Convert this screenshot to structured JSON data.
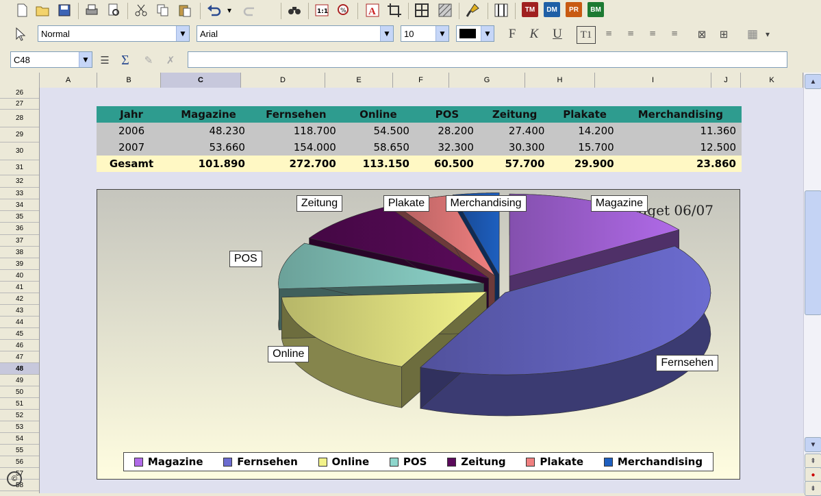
{
  "toolbar": {
    "style_value": "Normal",
    "font_value": "Arial",
    "size_value": "10",
    "font_color": "#000000",
    "badges": [
      "TM",
      "DM",
      "PR",
      "BM"
    ],
    "badge_colors": [
      "#a02020",
      "#1f5fa6",
      "#c85a12",
      "#1c7a32"
    ]
  },
  "formula_bar": {
    "cell_ref": "C48",
    "content": ""
  },
  "columns": [
    "A",
    "B",
    "C",
    "D",
    "E",
    "F",
    "G",
    "H",
    "I",
    "J",
    "K"
  ],
  "selected_column": "C",
  "rows": [
    "26",
    "27",
    "28",
    "29",
    "30",
    "31",
    "32",
    "33",
    "34",
    "35",
    "36",
    "37",
    "38",
    "39",
    "40",
    "41",
    "42",
    "43",
    "44",
    "45",
    "46",
    "47",
    "48",
    "49",
    "50",
    "51",
    "52",
    "53",
    "54",
    "55",
    "56",
    "57",
    "58"
  ],
  "selected_row": "48",
  "table": {
    "headers": [
      "Jahr",
      "Magazine",
      "Fernsehen",
      "Online",
      "POS",
      "Zeitung",
      "Plakate",
      "Merchandising"
    ],
    "rows": [
      [
        "2006",
        "48.230",
        "118.700",
        "54.500",
        "28.200",
        "27.400",
        "14.200",
        "11.360"
      ],
      [
        "2007",
        "53.660",
        "154.000",
        "58.650",
        "32.300",
        "30.300",
        "15.700",
        "12.500"
      ]
    ],
    "total": [
      "Gesamt",
      "101.890",
      "272.700",
      "113.150",
      "60.500",
      "57.700",
      "29.900",
      "23.860"
    ]
  },
  "chart_data": {
    "type": "pie",
    "title": "Marketingbudget 06/07",
    "categories": [
      "Magazine",
      "Fernsehen",
      "Online",
      "POS",
      "Zeitung",
      "Plakate",
      "Merchandising"
    ],
    "values": [
      101890,
      272700,
      113150,
      60500,
      57700,
      29900,
      23860
    ],
    "colors": [
      "#b06ae8",
      "#6c6cd0",
      "#f2f28a",
      "#8ed6cc",
      "#5a0a5a",
      "#f08080",
      "#1e5fbf"
    ],
    "legend_position": "bottom",
    "three_d": true,
    "exploded": true
  }
}
